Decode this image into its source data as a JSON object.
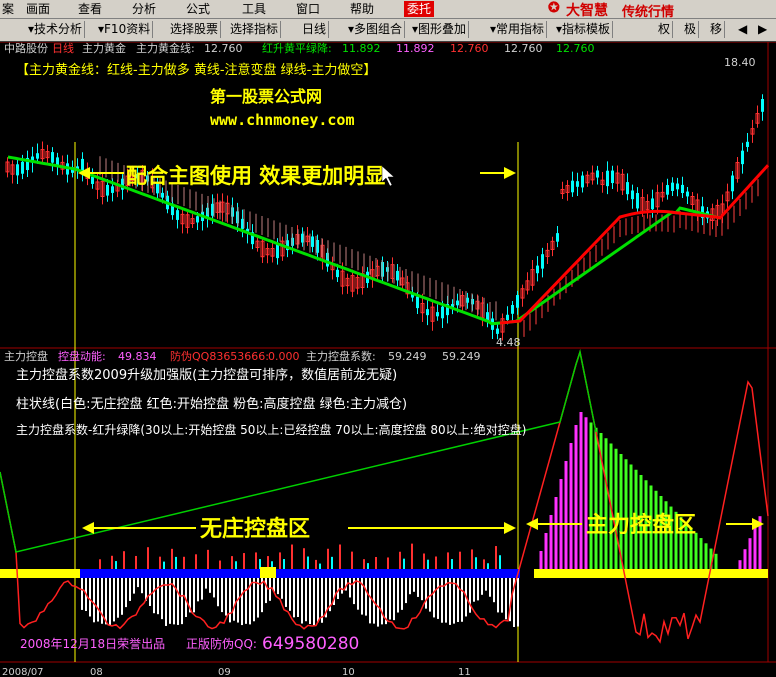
{
  "menu": {
    "items": [
      "案",
      "画面",
      "查看",
      "分析",
      "公式",
      "工具",
      "窗口",
      "帮助"
    ],
    "badge": "委托",
    "brand_name": "大智慧",
    "brand_tag": "传统行情"
  },
  "toolbar": {
    "items": [
      "技术分析",
      "F10资料",
      "选择股票",
      "选择指标",
      "日线",
      "多图组合",
      "图形叠加",
      "常用指标",
      "指标模板",
      "权",
      "极",
      "移"
    ]
  },
  "main_panel": {
    "stock": "中路股份",
    "period": "日线",
    "indicator": "主力黄金",
    "line1_label": "主力黄金线:",
    "line1_value": "12.760",
    "line2_label": "红升黄平绿降:",
    "line2_value": "11.892",
    "line3_value": "11.892",
    "line4_value": "12.760",
    "line5_value": "12.760",
    "line6_value": "12.760",
    "legend": "【主力黄金线：红线-主力做多   黄线-注意变盘   绿线-主力做空】",
    "site_name": "第一股票公式网",
    "site_url": "www.chnmoney.com",
    "annotation": "配合主图使用  效果更加明显",
    "price_high": "18.40",
    "price_low": "4.48"
  },
  "sub_panel": {
    "indicator": "主力控盘",
    "label1": "控盘动能:",
    "value1": "49.834",
    "label2": "防伪QQ83653666:",
    "value2": "0.000",
    "label3": "主力控盘系数:",
    "value3": "59.249",
    "value4": "59.249",
    "desc1": "主力控盘系数2009升级加强版(主力控盘可排序，数值居前龙无疑)",
    "desc2": "柱状线(白色:无庄控盘 红色:开始控盘 粉色:高度控盘 绿色:主力减仓)",
    "desc3": "主力控盘系数-红升绿降(30以上:开始控盘 50以上:已经控盘 70以上:高度控盘 80以上:绝对控盘)",
    "zone_left": "无庄控盘区",
    "zone_right": "主力控盘区",
    "footer_left": "2008年12月18日荣誉出品",
    "footer_mid": "正版防伪QQ:",
    "footer_qq": "649580280"
  },
  "date_axis": [
    "2008/07",
    "08",
    "09",
    "10",
    "11"
  ],
  "colors": {
    "up": "#ff3030",
    "down": "#00ffff",
    "green_line": "#00e000",
    "red_line": "#ff0000",
    "yellow": "#ffff00",
    "blue": "#0000ff",
    "magenta": "#ff00ff",
    "accent_text": "#ffff00"
  }
}
